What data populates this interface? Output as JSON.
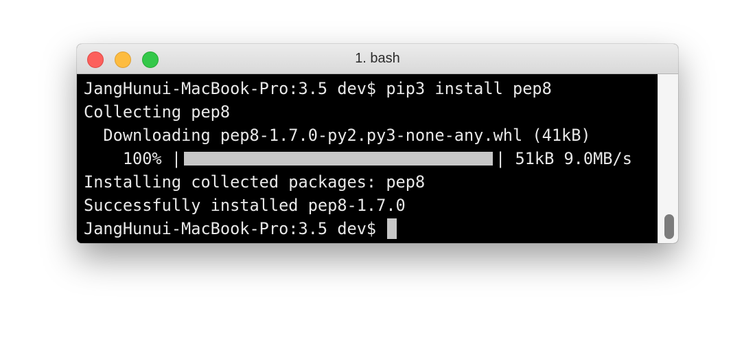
{
  "window": {
    "title": "1. bash"
  },
  "terminal": {
    "lines": [
      "JangHunui-MacBook-Pro:3.5 dev$ pip3 install pep8",
      "Collecting pep8",
      "  Downloading pep8-1.7.0-py2.py3-none-any.whl (41kB)",
      "Installing collected packages: pep8",
      "Successfully installed pep8-1.7.0"
    ],
    "progress": {
      "prefix": "    100% |",
      "suffix": "| 51kB 9.0MB/s",
      "fraction": 1.0
    },
    "prompt": "JangHunui-MacBook-Pro:3.5 dev$ "
  },
  "colors": {
    "background": "#000000",
    "text": "#e8e8e8",
    "progress_fill": "#c7c7c7",
    "close": "#fc605c",
    "minimize": "#fdbc40",
    "maximize": "#34c84a"
  },
  "icons": {
    "close": "close-button-icon",
    "minimize": "minimize-button-icon",
    "maximize": "zoom-button-icon"
  }
}
